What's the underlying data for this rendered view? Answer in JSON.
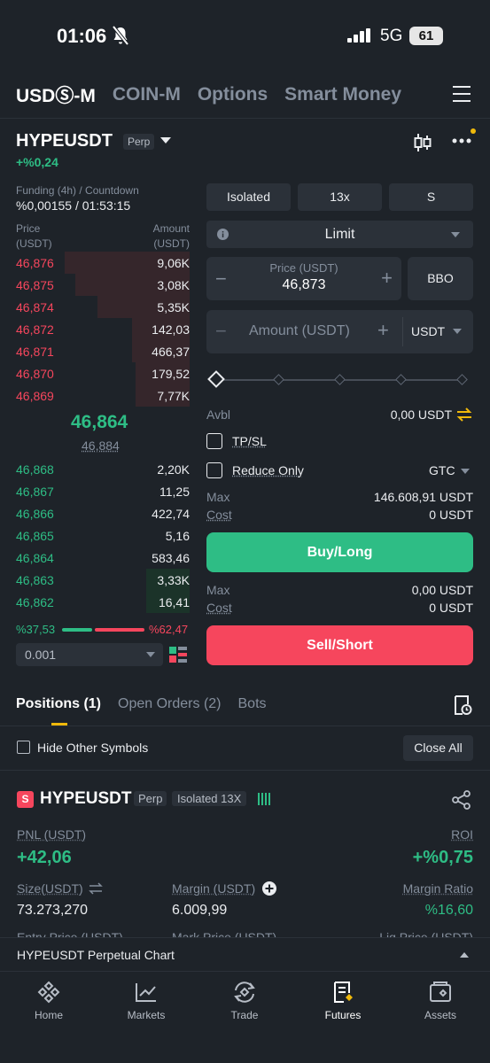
{
  "status": {
    "time": "01:06",
    "network": "5G",
    "battery": "61"
  },
  "top_tabs": [
    {
      "label": "USDⓈ-M",
      "active": true
    },
    {
      "label": "COIN-M",
      "active": false
    },
    {
      "label": "Options",
      "active": false
    },
    {
      "label": "Smart Money",
      "active": false
    }
  ],
  "symbol": {
    "name": "HYPEUSDT",
    "badge": "Perp",
    "change": "+%0,24"
  },
  "funding": {
    "label": "Funding (4h) / Countdown",
    "value": "%0,00155 / 01:53:15"
  },
  "orderbook": {
    "head_left": [
      "Price",
      "(USDT)"
    ],
    "head_right": [
      "Amount",
      "(USDT)"
    ],
    "asks": [
      {
        "price": "46,876",
        "amount": "9,06K",
        "depth": 0.72
      },
      {
        "price": "46,875",
        "amount": "3,08K",
        "depth": 0.66
      },
      {
        "price": "46,874",
        "amount": "5,35K",
        "depth": 0.53
      },
      {
        "price": "46,872",
        "amount": "142,03",
        "depth": 0.33
      },
      {
        "price": "46,871",
        "amount": "466,37",
        "depth": 0.33
      },
      {
        "price": "46,870",
        "amount": "179,52",
        "depth": 0.31
      },
      {
        "price": "46,869",
        "amount": "7,77K",
        "depth": 0.31
      }
    ],
    "mid_price": "46,864",
    "mark_price": "46,884",
    "bids": [
      {
        "price": "46,868",
        "amount": "2,20K",
        "depth": 0.0
      },
      {
        "price": "46,867",
        "amount": "11,25",
        "depth": 0.0
      },
      {
        "price": "46,866",
        "amount": "422,74",
        "depth": 0.0
      },
      {
        "price": "46,865",
        "amount": "5,16",
        "depth": 0.0
      },
      {
        "price": "46,864",
        "amount": "583,46",
        "depth": 0.0
      },
      {
        "price": "46,863",
        "amount": "3,33K",
        "depth": 0.25
      },
      {
        "price": "46,862",
        "amount": "16,41",
        "depth": 0.25
      }
    ],
    "buy_ratio": "%37,53",
    "sell_ratio": "%62,47",
    "precision": "0.001"
  },
  "form": {
    "margin_mode": "Isolated",
    "leverage": "13x",
    "mode": "S",
    "order_type": "Limit",
    "price_label": "Price (USDT)",
    "price_value": "46,873",
    "bbo": "BBO",
    "amount_placeholder": "Amount (USDT)",
    "amount_unit": "USDT",
    "avbl_label": "Avbl",
    "avbl_value": "0,00 USDT",
    "tpsl": "TP/SL",
    "reduce_only": "Reduce Only",
    "tif": "GTC",
    "buy_max_label": "Max",
    "buy_max_value": "146.608,91 USDT",
    "buy_cost_label": "Cost",
    "buy_cost_value": "0 USDT",
    "buy_button": "Buy/Long",
    "sell_max_label": "Max",
    "sell_max_value": "0,00 USDT",
    "sell_cost_label": "Cost",
    "sell_cost_value": "0 USDT",
    "sell_button": "Sell/Short"
  },
  "positions_tabs": [
    "Positions (1)",
    "Open Orders (2)",
    "Bots"
  ],
  "hide_other": "Hide Other Symbols",
  "close_all": "Close All",
  "position": {
    "side": "S",
    "symbol": "HYPEUSDT",
    "badge": "Perp",
    "margin_mode": "Isolated 13X",
    "pnl_label": "PNL (USDT)",
    "pnl_value": "+42,06",
    "roi_label": "ROI",
    "roi_value": "+%0,75",
    "size_label": "Size(USDT)",
    "size_value": "73.273,270",
    "margin_label": "Margin (USDT)",
    "margin_value": "6.009,99",
    "ratio_label": "Margin Ratio",
    "ratio_value": "%16,60",
    "entry_label": "Entry Price (USDT)",
    "mark_label": "Mark Price (USDT)",
    "liq_label": "Liq.Price (USDT)"
  },
  "chart_bar": "HYPEUSDT Perpetual Chart",
  "nav": [
    {
      "label": "Home",
      "icon": "home-icon"
    },
    {
      "label": "Markets",
      "icon": "markets-icon"
    },
    {
      "label": "Trade",
      "icon": "trade-icon"
    },
    {
      "label": "Futures",
      "icon": "futures-icon",
      "active": true
    },
    {
      "label": "Assets",
      "icon": "assets-icon"
    }
  ],
  "colors": {
    "buy": "#2ebd85",
    "sell": "#f6465d",
    "accent": "#f0b90b",
    "bg": "#1e2329"
  }
}
